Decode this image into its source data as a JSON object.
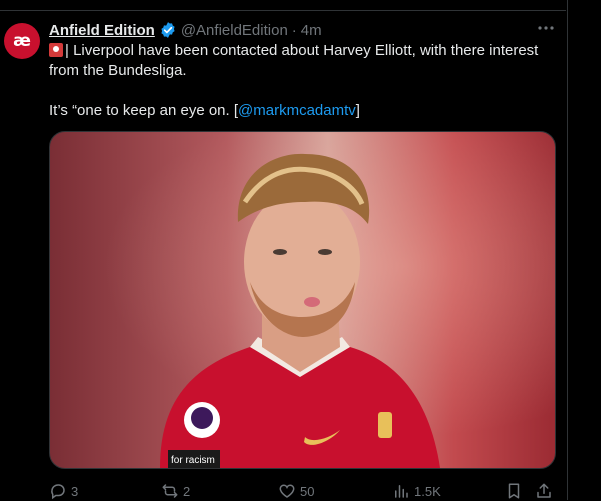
{
  "tweet": {
    "author_name": "Anfield Edition",
    "handle": "@AnfieldEdition",
    "separator": "·",
    "time": "4m",
    "avatar_text": "æ",
    "text_line1": "| Liverpool have been contacted about Harvey Elliott, with there interest from the Bundesliga.",
    "text_line2": "It’s “one to keep an eye on. [",
    "mention": "@markmcadamtv",
    "text_line2_end": "]",
    "media_icon": "photo-of-footballer-in-red-kit",
    "shirt_text": "for racism"
  },
  "actions": {
    "replies": "3",
    "reposts": "2",
    "likes": "50",
    "views": "1.5K"
  },
  "colors": {
    "accent": "#1d9bf0",
    "background": "#000000",
    "muted": "#71767b",
    "text": "#e7e9ea",
    "brand": "#c8102e"
  }
}
